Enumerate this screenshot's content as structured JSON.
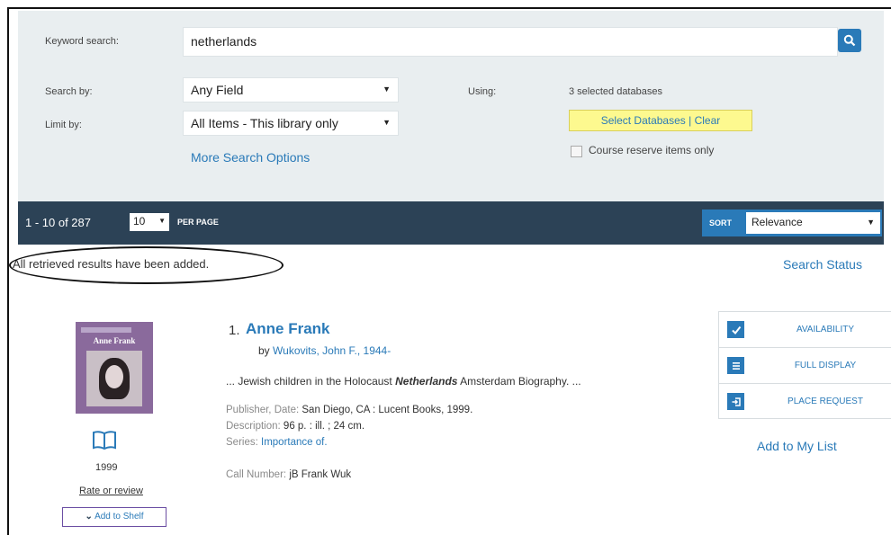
{
  "search": {
    "keyword_label": "Keyword search:",
    "keyword_value": "netherlands",
    "search_by_label": "Search by:",
    "search_by_value": "Any Field",
    "limit_by_label": "Limit by:",
    "limit_by_value": "All Items - This library only",
    "more_options": "More Search Options",
    "using_label": "Using:",
    "databases_count": "3 selected databases",
    "select_databases": "Select Databases",
    "clear": "| Clear",
    "course_reserve": "Course reserve items only"
  },
  "results_bar": {
    "range": "1 - 10 of 287",
    "per_page_value": "10",
    "per_page_label": "PER PAGE",
    "sort_label": "SORT",
    "sort_value": "Relevance"
  },
  "status": {
    "message": "All retrieved results have been added.",
    "search_status": "Search Status"
  },
  "result": {
    "number": "1.",
    "title": "Anne Frank",
    "by": "by",
    "author": "Wukovits, John F., 1944-",
    "snippet_pre": "... Jewish children in the Holocaust",
    "snippet_em": "Netherlands",
    "snippet_post": "Amsterdam Biography. ...",
    "publisher_label": "Publisher, Date:",
    "publisher_value": "San Diego, CA : Lucent Books, 1999.",
    "description_label": "Description:",
    "description_value": "96 p. : ill. ; 24 cm.",
    "series_label": "Series:",
    "series_value": "Importance of.",
    "call_label": "Call Number:",
    "call_value": "jB Frank Wuk",
    "cover_title": "Anne Frank",
    "year": "1999",
    "rate": "Rate or review",
    "add_shelf": "Add to Shelf",
    "actions": [
      "AVAILABILITY",
      "FULL DISPLAY",
      "PLACE REQUEST"
    ],
    "add_list": "Add to My List"
  },
  "colors": {
    "accent": "#2a7ab8",
    "bar": "#2c4256",
    "panel": "#e9eef0",
    "highlight": "#fdf98f"
  }
}
